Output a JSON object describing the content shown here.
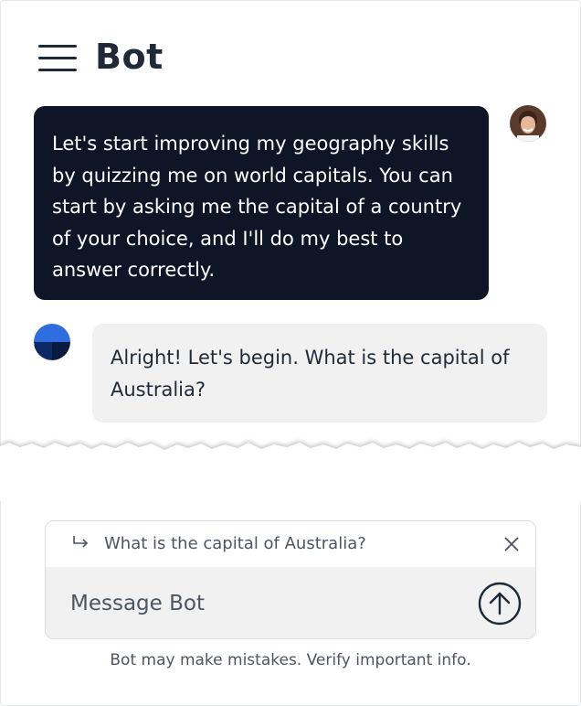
{
  "header": {
    "title": "Bot",
    "menu_icon": "hamburger-menu-icon"
  },
  "messages": [
    {
      "role": "user",
      "text": "Let's start improving my geography skills by quizzing me on world capitals. You can start by asking me the capital of a country of your choice, and I'll do my best to answer correctly."
    },
    {
      "role": "bot",
      "text": "Alright! Let's begin. What is the capital of Australia?"
    }
  ],
  "composer": {
    "reply_preview": "What is the capital of Australia?",
    "placeholder": "Message Bot",
    "value": "",
    "icons": [
      "reply-arrow-icon",
      "close-icon",
      "send-arrow-up-icon"
    ]
  },
  "footer": {
    "disclaimer": "Bot may make mistakes. Verify important info."
  },
  "colors": {
    "user_bubble": "#0d1526",
    "bot_bubble": "#f1f1f2",
    "text_dark": "#1f2937",
    "muted_text": "#4b5563",
    "bot_avatar": "#1e4fa8"
  }
}
